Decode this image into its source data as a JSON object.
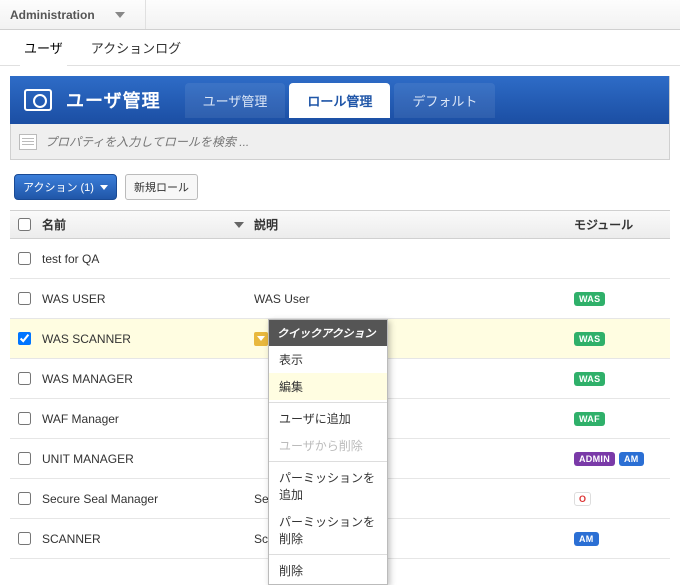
{
  "topbar": {
    "menu": "Administration"
  },
  "subnav": {
    "tab_user": "ユーザ",
    "tab_log": "アクションログ",
    "active": "ユーザ"
  },
  "panel": {
    "title": "ユーザ管理",
    "tabs": {
      "user_mgmt": "ユーザ管理",
      "role_mgmt": "ロール管理",
      "defaults": "デフォルト"
    },
    "active_tab": "ロール管理",
    "search_placeholder": "プロパティを入力してロールを検索 ..."
  },
  "actions": {
    "actions_btn": "アクション (1)",
    "new_role_btn": "新規ロール"
  },
  "columns": {
    "name": "名前",
    "desc": "説明",
    "module": "モジュール"
  },
  "rows": [
    {
      "name": "test for QA",
      "desc": "",
      "modules": [],
      "selected": false
    },
    {
      "name": "WAS USER",
      "desc": "WAS User",
      "modules": [
        "WAS"
      ],
      "selected": false
    },
    {
      "name": "WAS SCANNER",
      "desc": "",
      "modules": [
        "WAS"
      ],
      "selected": true
    },
    {
      "name": "WAS MANAGER",
      "desc": "",
      "modules": [
        "WAS"
      ],
      "selected": false
    },
    {
      "name": "WAF Manager",
      "desc": "",
      "modules": [
        "WAF"
      ],
      "selected": false
    },
    {
      "name": "UNIT MANAGER",
      "desc": "",
      "modules": [
        "ADMIN",
        "AM"
      ],
      "selected": false
    },
    {
      "name": "Secure Seal Manager",
      "desc": "Secure Seal Manger",
      "modules": [
        "SEAL"
      ],
      "selected": false
    },
    {
      "name": "SCANNER",
      "desc": "Scanner User",
      "modules": [
        "AM"
      ],
      "selected": false
    }
  ],
  "ctx": {
    "header": "クイックアクション",
    "items": [
      {
        "label": "表示",
        "enabled": true
      },
      {
        "label": "編集",
        "enabled": true,
        "hover": true
      },
      {
        "sep": true
      },
      {
        "label": "ユーザに追加",
        "enabled": true
      },
      {
        "label": "ユーザから削除",
        "enabled": false
      },
      {
        "sep": true
      },
      {
        "label": "パーミッションを追加",
        "enabled": true
      },
      {
        "label": "パーミッションを削除",
        "enabled": true
      },
      {
        "sep": true
      },
      {
        "label": "削除",
        "enabled": true
      }
    ]
  },
  "badge_labels": {
    "WAS": "WAS",
    "WAF": "WAF",
    "ADMIN": "ADMIN",
    "AM": "AM",
    "SEAL": "O"
  }
}
